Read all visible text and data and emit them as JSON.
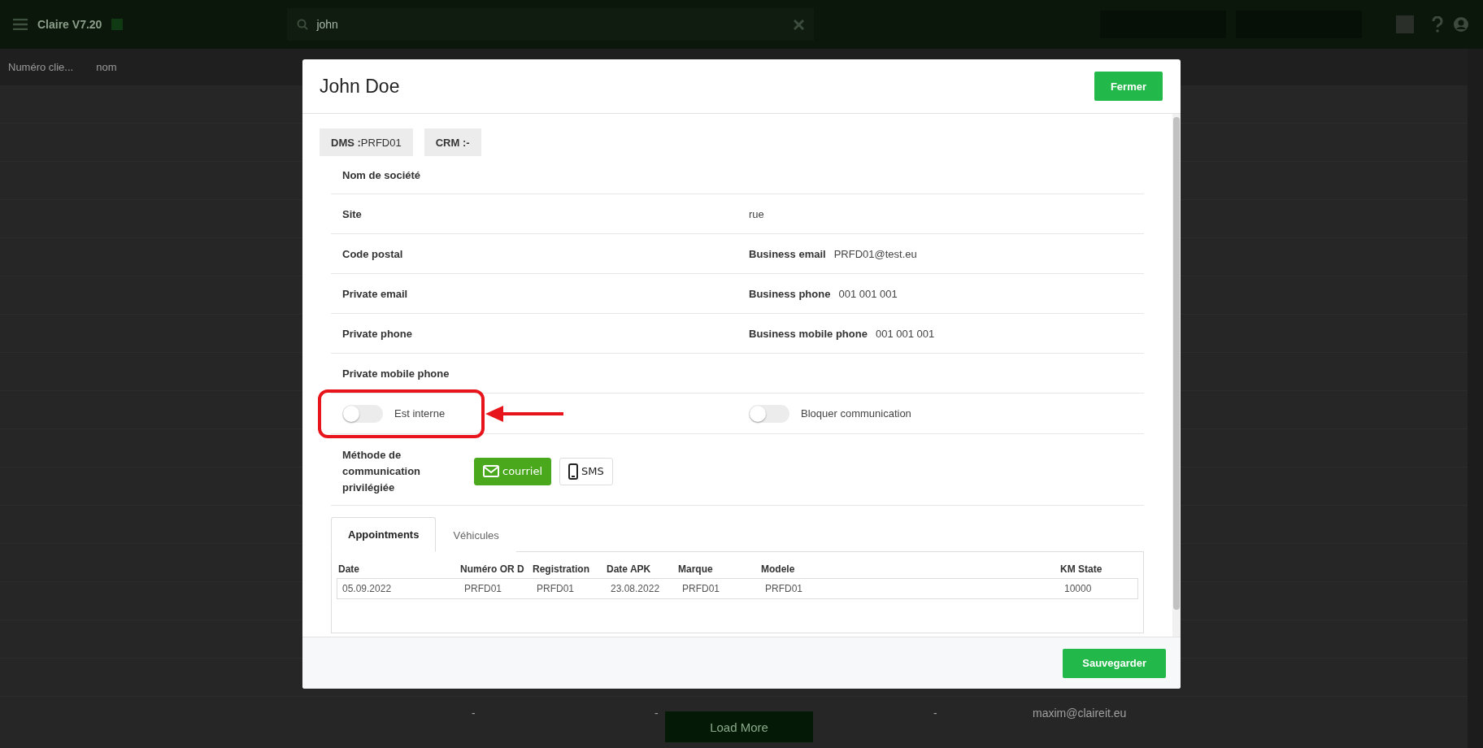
{
  "app": {
    "title": "Claire V7.20",
    "search": {
      "value": "john"
    }
  },
  "list": {
    "columns": [
      "Numéro clie...",
      "nom"
    ],
    "footer_cells": [
      "-",
      "-",
      "-",
      "maxim@claireit.eu"
    ],
    "load_more": "Load More"
  },
  "dialog": {
    "title": "John Doe",
    "close": "Fermer",
    "badges": [
      {
        "label": "DMS :",
        "value": "PRFD01"
      },
      {
        "label": "CRM :-"
      }
    ],
    "fields": [
      {
        "left": {
          "label": "Nom de société"
        }
      },
      {
        "left": {
          "label": "Site"
        },
        "right": {
          "value": "rue"
        }
      },
      {
        "left": {
          "label": "Code postal"
        },
        "right": {
          "label": "Business email",
          "value": "PRFD01@test.eu"
        }
      },
      {
        "left": {
          "label": "Private email"
        },
        "right": {
          "label": "Business phone",
          "value": "001 001 001"
        }
      },
      {
        "left": {
          "label": "Private phone"
        },
        "right": {
          "label": "Business mobile phone",
          "value": "001 001 001"
        }
      },
      {
        "left": {
          "label": "Private mobile phone"
        }
      }
    ],
    "toggles": [
      {
        "label": "Est interne",
        "on": false,
        "highlighted": true
      },
      {
        "label": "Bloquer communication",
        "on": false,
        "highlighted": false
      }
    ],
    "preferred_method": {
      "label": "Méthode de communication privilégiée",
      "options": [
        {
          "label": "courriel",
          "kind": "mail",
          "selected": true
        },
        {
          "label": "SMS",
          "kind": "phone",
          "selected": false
        }
      ]
    },
    "tabs": [
      {
        "label": "Appointments",
        "selected": true
      },
      {
        "label": "Véhicules",
        "selected": false
      }
    ],
    "table": {
      "columns": [
        "Date",
        "Numéro OR D",
        "Registration",
        "Date APK",
        "Marque",
        "Modele",
        "KM State"
      ],
      "rows": [
        [
          "05.09.2022",
          "PRFD01",
          "PRFD01",
          "23.08.2022",
          "PRFD01",
          "PRFD01",
          "10000"
        ]
      ]
    },
    "save": "Sauvegarder"
  }
}
